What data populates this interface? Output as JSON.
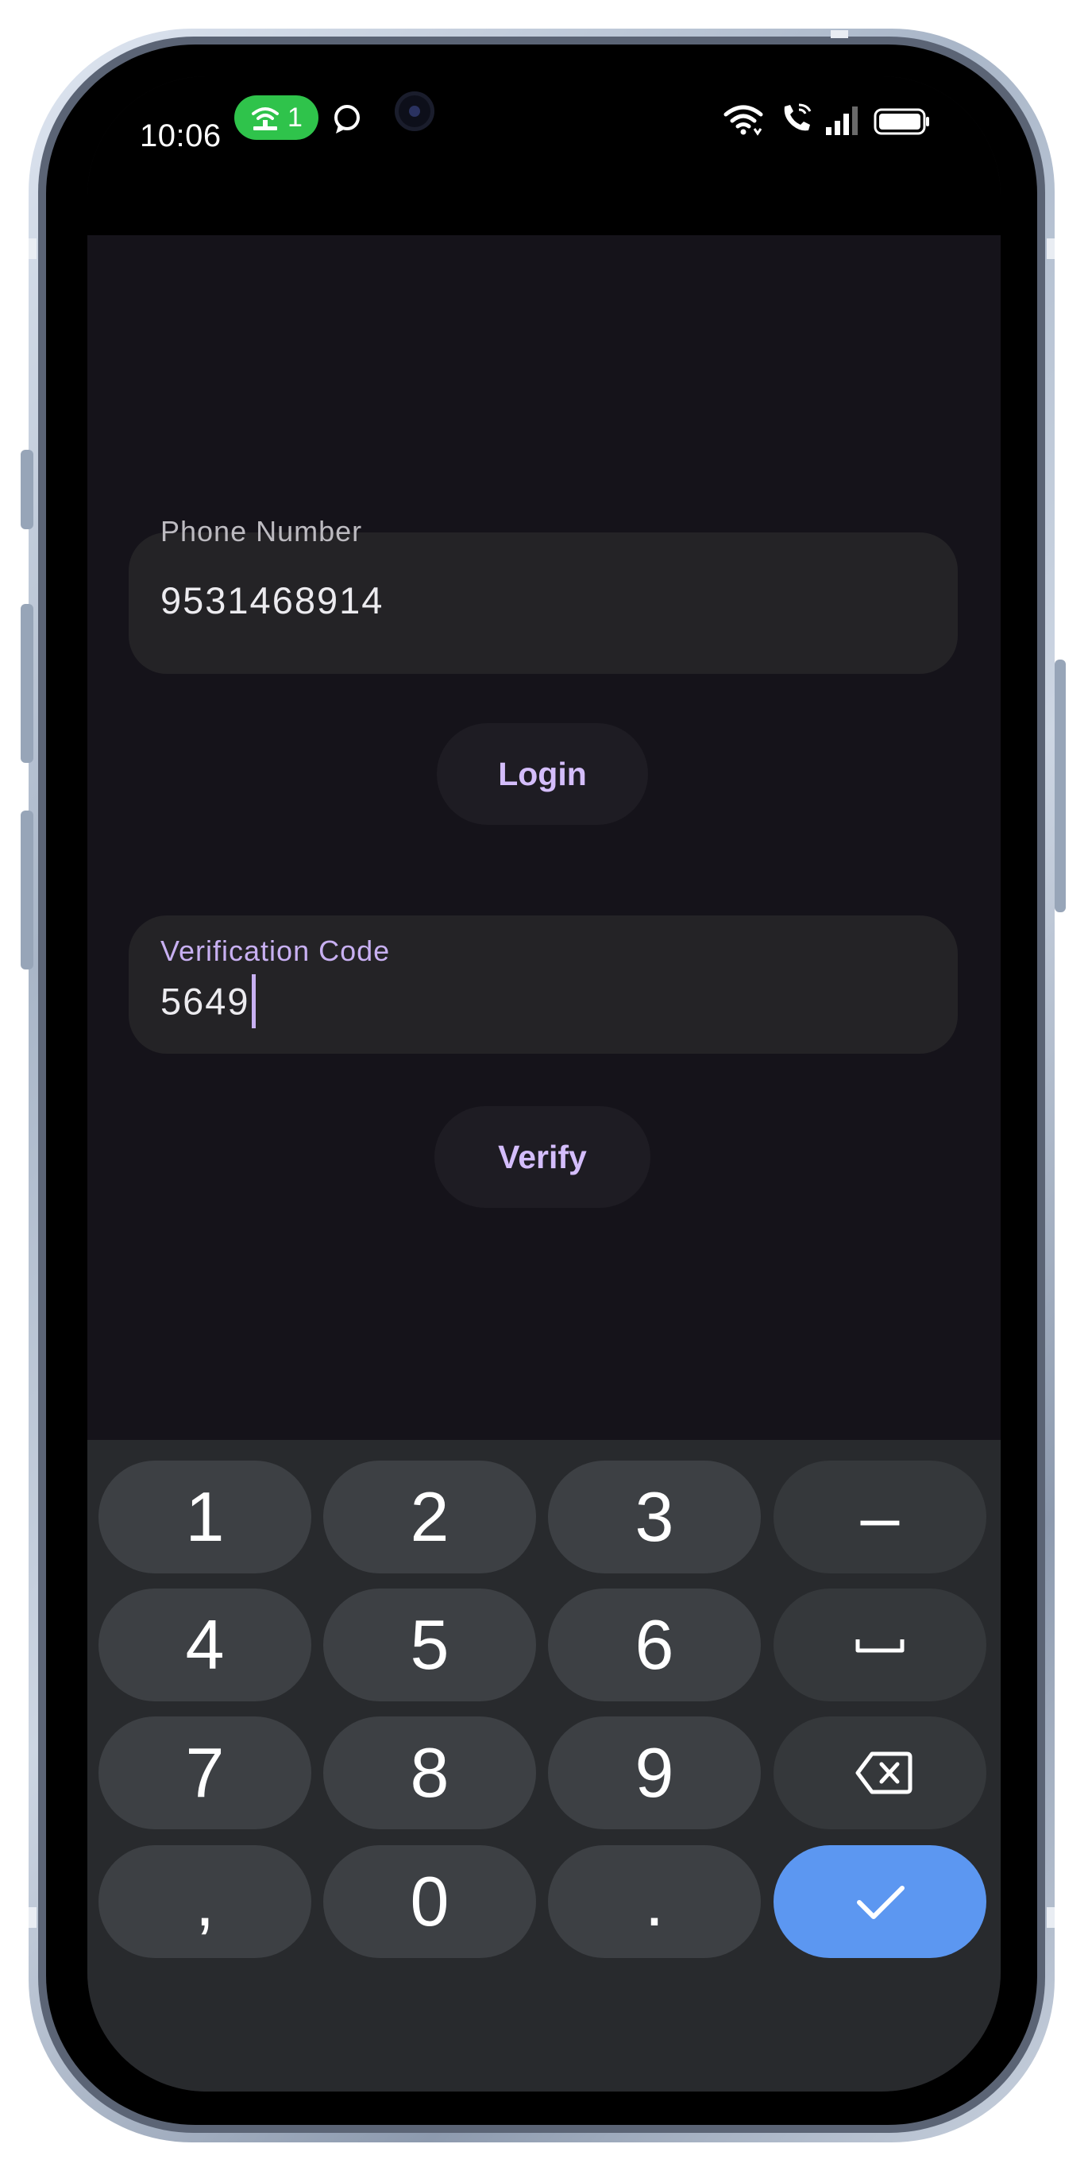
{
  "status_bar": {
    "time": "10:06",
    "hotspot_count": "1"
  },
  "login_form": {
    "phone_field": {
      "label": "Phone Number",
      "value": "9531468914"
    },
    "login_button": "Login",
    "code_field": {
      "label": "Verification Code",
      "value": "5649"
    },
    "verify_button": "Verify"
  },
  "keyboard": {
    "row1": [
      "1",
      "2",
      "3",
      "–"
    ],
    "row2": [
      "4",
      "5",
      "6"
    ],
    "row3": [
      "7",
      "8",
      "9"
    ],
    "row4": [
      ",",
      "0",
      "."
    ]
  },
  "colors": {
    "accent": "#c8b0f2",
    "hotspot": "#2fc34b",
    "enter_key": "#5c97f1"
  }
}
